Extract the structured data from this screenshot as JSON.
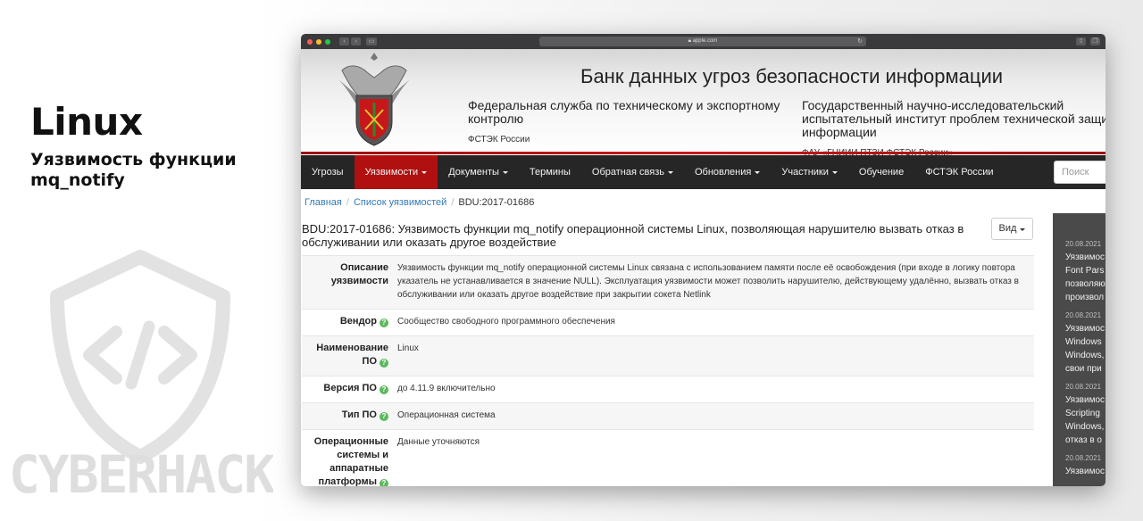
{
  "promo": {
    "title": "Linux",
    "subtitle": "Уязвимость функции mq_notify",
    "brand": "CYBERHACK"
  },
  "browser": {
    "url": "apple.com"
  },
  "site": {
    "title": "Банк данных угроз безопасности информации",
    "org1": "Федеральная служба по техническому и экспортному контролю",
    "org1_short": "ФСТЭК России",
    "org2": "Государственный научно-исследовательский испытательный институт проблем технической защиты информации",
    "org2_short": "ФАУ «ГНИИИ ПТЗИ ФСТЭК России»"
  },
  "nav": {
    "items": [
      {
        "label": "Угрозы"
      },
      {
        "label": "Уязвимости"
      },
      {
        "label": "Документы"
      },
      {
        "label": "Термины"
      },
      {
        "label": "Обратная связь"
      },
      {
        "label": "Обновления"
      },
      {
        "label": "Участники"
      },
      {
        "label": "Обучение"
      },
      {
        "label": "ФСТЭК России"
      }
    ],
    "search_placeholder": "Поиск"
  },
  "breadcrumb": {
    "home": "Главная",
    "list": "Список уязвимостей",
    "current": "BDU:2017-01686"
  },
  "vulnerability": {
    "title": "BDU:2017-01686: Уязвимость функции mq_notify операционной системы Linux, позволяющая нарушителю вызвать отказ в обслуживании или оказать другое воздействие",
    "view_label": "Вид",
    "rows": [
      {
        "key": "Описание уязвимости",
        "value": "Уязвимость функции mq_notify операционной системы Linux связана с использованием памяти после её освобождения (при входе в логику повтора указатель не устанавливается в значение NULL). Эксплуатация уязвимости может позволить нарушителю, действующему удалённо, вызвать отказ в обслуживании или оказать другое воздействие при закрытии сокета Netlink"
      },
      {
        "key": "Вендор",
        "value": "Сообщество свободного программного обеспечения"
      },
      {
        "key": "Наименование ПО",
        "value": "Linux"
      },
      {
        "key": "Версия ПО",
        "value": "до 4.11.9 включительно"
      },
      {
        "key": "Тип ПО",
        "value": "Операционная система"
      },
      {
        "key": "Операционные системы и аппаратные платформы",
        "value": "Данные уточняются"
      }
    ]
  },
  "sidebar": {
    "news": [
      {
        "date": "20.08.2021",
        "lines": [
          "Уязвимос",
          "Font Pars",
          "позволяю",
          "произвол"
        ]
      },
      {
        "date": "20.08.2021",
        "lines": [
          "Уязвимос",
          "Windows",
          "Windows,",
          "свои при"
        ]
      },
      {
        "date": "20.08.2021",
        "lines": [
          "Уязвимос",
          "Scripting",
          "Windows,",
          "отказ в о"
        ]
      },
      {
        "date": "20.08.2021",
        "lines": [
          "Уязвимос"
        ]
      }
    ]
  }
}
